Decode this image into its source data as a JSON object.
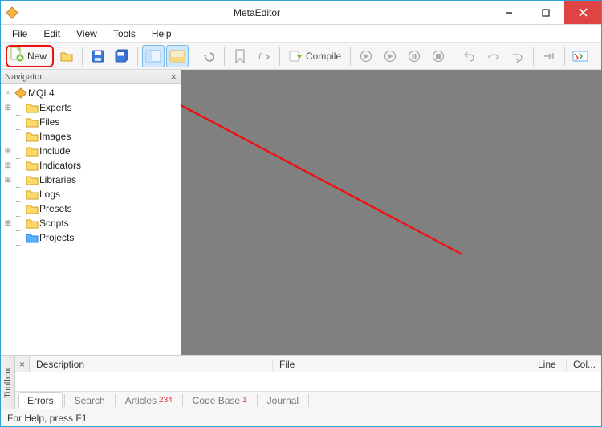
{
  "window": {
    "title": "MetaEditor"
  },
  "menu": {
    "file": "File",
    "edit": "Edit",
    "view": "View",
    "tools": "Tools",
    "help": "Help"
  },
  "toolbar": {
    "new_label": "New",
    "compile_label": "Compile"
  },
  "navigator": {
    "title": "Navigator",
    "root": "MQL4",
    "items": [
      {
        "label": "Experts",
        "expandable": true
      },
      {
        "label": "Files",
        "expandable": false
      },
      {
        "label": "Images",
        "expandable": false
      },
      {
        "label": "Include",
        "expandable": true
      },
      {
        "label": "Indicators",
        "expandable": true
      },
      {
        "label": "Libraries",
        "expandable": true
      },
      {
        "label": "Logs",
        "expandable": false
      },
      {
        "label": "Presets",
        "expandable": false
      },
      {
        "label": "Scripts",
        "expandable": true
      },
      {
        "label": "Projects",
        "expandable": false,
        "blue": true
      }
    ]
  },
  "toolbox": {
    "title": "Toolbox",
    "cols": {
      "description": "Description",
      "file": "File",
      "line": "Line",
      "col": "Col..."
    },
    "tabs": {
      "errors": "Errors",
      "search": "Search",
      "articles": "Articles",
      "articles_badge": "234",
      "codebase": "Code Base",
      "codebase_badge": "1",
      "journal": "Journal"
    }
  },
  "status": {
    "text": "For Help, press F1"
  },
  "icons": {
    "folder_fill": "#ffd96a",
    "folder_stroke": "#c9a227",
    "blue_folder_fill": "#5ab0ff",
    "blue_folder_stroke": "#2b7fd4"
  }
}
